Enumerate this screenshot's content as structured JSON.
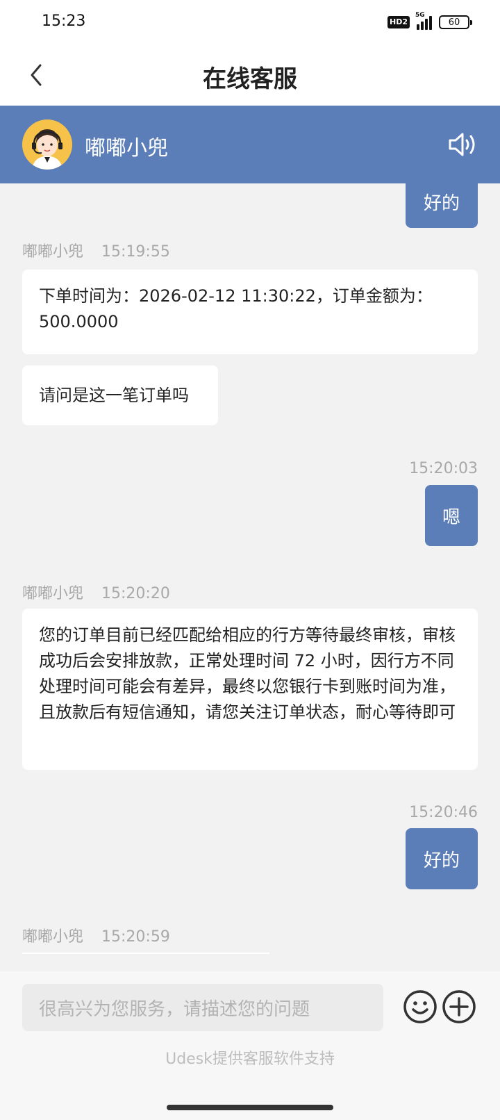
{
  "status_bar": {
    "time": "15:23",
    "hd_badge": "HD2",
    "network": "5G",
    "battery": "60"
  },
  "nav": {
    "title": "在线客服"
  },
  "agent": {
    "name": "嘟嘟小兜"
  },
  "messages": {
    "m0": {
      "text": "好的"
    },
    "m1": {
      "sender": "嘟嘟小兜",
      "time": "15:19:55",
      "text": "下单时间为：2026-02-12 11:30:22，订单金额为：500.0000"
    },
    "m2": {
      "text": "请问是这一笔订单吗"
    },
    "m3": {
      "time": "15:20:03",
      "text": "嗯"
    },
    "m4": {
      "sender": "嘟嘟小兜",
      "time": "15:20:20",
      "text": "您的订单目前已经匹配给相应的行方等待最终审核，审核成功后会安排放款，正常处理时间 72 小时，因行方不同处理时间可能会有差异，最终以您银行卡到账时间为准，且放款后有短信通知，请您关注订单状态，耐心等待即可"
    },
    "m5": {
      "time": "15:20:46",
      "text": "好的"
    },
    "m6": {
      "sender": "嘟嘟小兜",
      "time": "15:20:59"
    }
  },
  "input": {
    "placeholder": "很高兴为您服务，请描述您的问题"
  },
  "footer": {
    "powered_by": "Udesk提供客服软件支持"
  },
  "icons": {
    "back": "chevron-left-icon",
    "sound": "speaker-icon",
    "emoji": "smiley-icon",
    "plus": "plus-circle-icon"
  },
  "colors": {
    "accent": "#5b7db8",
    "background": "#f2f2f2",
    "bubble_left": "#ffffff"
  }
}
